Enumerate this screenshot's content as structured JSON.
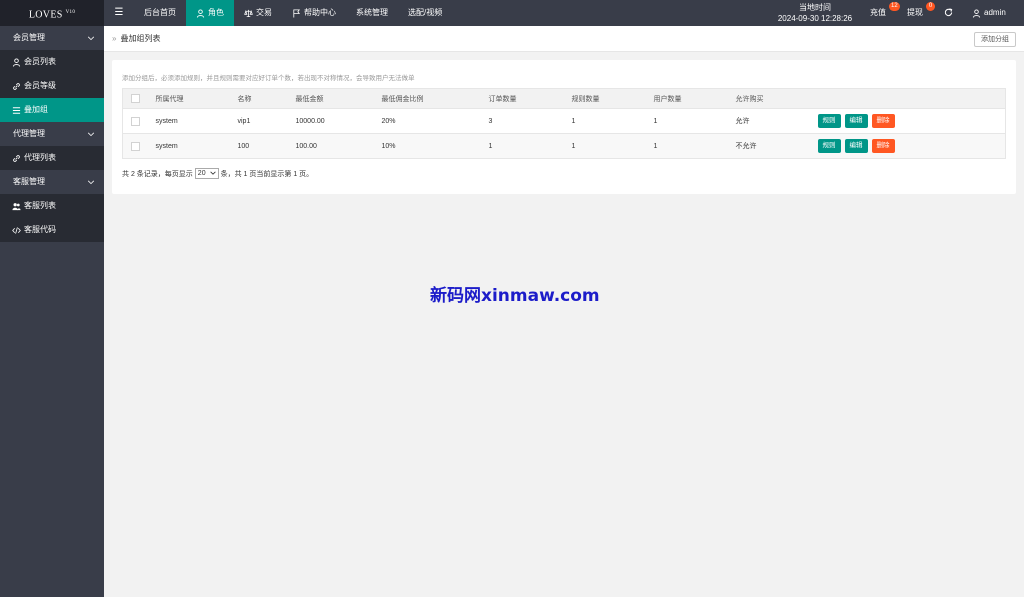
{
  "header": {
    "logo": "LOVES",
    "logo_sup": "V10",
    "nav": [
      {
        "label": "后台首页",
        "icon": "none"
      },
      {
        "label": "角色",
        "icon": "user-icon"
      },
      {
        "label": "交易",
        "icon": "scale-icon"
      },
      {
        "label": "帮助中心",
        "icon": "flag-icon"
      },
      {
        "label": "系统管理",
        "icon": "none"
      },
      {
        "label": "选配/视频",
        "icon": "none"
      }
    ],
    "time_label": "当地时间",
    "time_value": "2024-09-30 12:28:26",
    "recharge": "充值",
    "recharge_badge": "12",
    "withdraw": "提现",
    "withdraw_badge": "0",
    "user": "admin"
  },
  "sidebar": {
    "groups": [
      {
        "label": "会员管理",
        "items": [
          "会员列表",
          "会员等级",
          "叠加组"
        ]
      },
      {
        "label": "代理管理",
        "items": [
          "代理列表"
        ]
      },
      {
        "label": "客服管理",
        "items": [
          "客服列表",
          "客服代码"
        ]
      }
    ]
  },
  "page": {
    "breadcrumb": "叠加组列表",
    "add_button": "添加分组",
    "tip": "添加分组后，必须添加规则，并且规则需要对应好订单个数，若出现不对称情况，会导致用户无法做单"
  },
  "table": {
    "columns": [
      "所属代理",
      "名称",
      "最低金额",
      "最低佣金比例",
      "订单数量",
      "规则数量",
      "用户数量",
      "允许购买"
    ],
    "rows": [
      [
        "system",
        "vip1",
        "10000.00",
        "20%",
        "3",
        "1",
        "1",
        "允许"
      ],
      [
        "system",
        "100",
        "100.00",
        "10%",
        "1",
        "1",
        "1",
        "不允许"
      ]
    ],
    "actions": [
      "规则",
      "编辑",
      "删除"
    ]
  },
  "pager": {
    "prefix": "共 2 条记录，每页显示",
    "page_size": "20",
    "suffix": "条，共 1 页当前显示第 1 页。"
  },
  "watermark": "新码网xinmaw.com"
}
